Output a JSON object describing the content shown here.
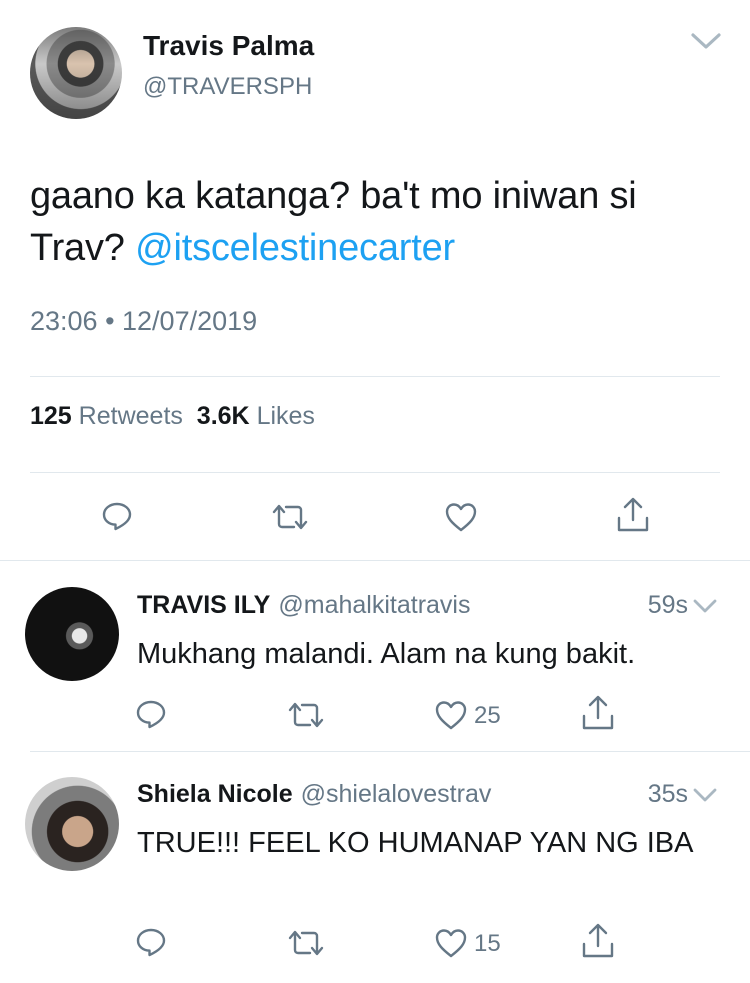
{
  "main_tweet": {
    "author_name": "Travis Palma",
    "author_handle": "@TRAVERSPH",
    "text_plain": "gaano ka katanga? ba't mo iniwan si Trav? ",
    "text_mention": "@itscelestinecarter",
    "timestamp": "23:06 • 12/07/2019",
    "retweets_count": "125",
    "retweets_label": "Retweets",
    "likes_count": "3.6K",
    "likes_label": "Likes"
  },
  "replies": [
    {
      "name": "TRAVIS ILY",
      "handle": "@mahalkitatravis",
      "time": "59s",
      "text": "Mukhang malandi. Alam na kung bakit.",
      "like_count": "25"
    },
    {
      "name": "Shiela Nicole",
      "handle": "@shielalovestrav",
      "time": "35s",
      "text": "TRUE!!! FEEL KO HUMANAP YAN NG IBA",
      "like_count": "15"
    }
  ],
  "icons": {
    "reply": "reply-icon",
    "retweet": "retweet-icon",
    "like": "heart-icon",
    "share": "share-icon",
    "menu": "chevron-down-icon"
  },
  "colors": {
    "text": "#14171a",
    "secondary": "#657786",
    "mention": "#1da1f2",
    "divider": "#e1e8ed"
  }
}
